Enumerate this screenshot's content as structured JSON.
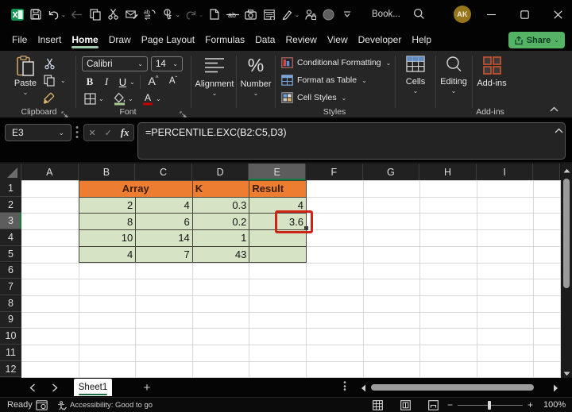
{
  "colors": {
    "excel_green": "#107C41",
    "share_button_green": "#55b366",
    "active_tab_underline": "#9fc7ab",
    "table_header_orange": "#ED7D31",
    "table_header_text": "#3B1D02",
    "table_cell_green": "#D6E4C5",
    "annotation_red": "#CD2418",
    "avatar_gold": "#96751b"
  },
  "title_bar": {
    "title": "Book...",
    "avatar_initials": "AK",
    "quick_access": [
      {
        "name": "excel-logo"
      },
      {
        "name": "save"
      },
      {
        "name": "undo",
        "dropdown": true
      },
      {
        "name": "back",
        "disabled": true
      },
      {
        "name": "copy"
      },
      {
        "name": "cut"
      },
      {
        "name": "email-draft"
      },
      {
        "name": "find-replace"
      },
      {
        "name": "touch-mode",
        "dropdown": true
      },
      {
        "name": "redo",
        "disabled": true,
        "dropdown": true
      },
      {
        "name": "new-file"
      },
      {
        "name": "strikethrough"
      },
      {
        "name": "camera"
      },
      {
        "name": "form"
      },
      {
        "name": "draw",
        "dropdown": true
      },
      {
        "name": "permissions"
      },
      {
        "name": "presence"
      },
      {
        "name": "more-commands"
      }
    ]
  },
  "menu": {
    "tabs": [
      "File",
      "Insert",
      "Home",
      "Draw",
      "Page Layout",
      "Formulas",
      "Data",
      "Review",
      "View",
      "Developer",
      "Help"
    ],
    "active_tab": "Home",
    "share_label": "Share"
  },
  "ribbon": {
    "clipboard": {
      "paste_label": "Paste",
      "group_label": "Clipboard"
    },
    "font": {
      "font_name": "Calibri",
      "font_size": "14",
      "bold": "B",
      "italic": "I",
      "underline": "U",
      "group_label": "Font"
    },
    "alignment": {
      "label": "Alignment"
    },
    "number": {
      "label": "Number"
    },
    "styles": {
      "conditional_formatting": "Conditional Formatting",
      "format_as_table": "Format as Table",
      "cell_styles": "Cell Styles",
      "group_label": "Styles"
    },
    "cells": {
      "label": "Cells"
    },
    "editing": {
      "label": "Editing"
    },
    "addins": {
      "label": "Add-ins",
      "group_label": "Add-ins"
    }
  },
  "formula_bar": {
    "name_box": "E3",
    "formula": "=PERCENTILE.EXC(B2:C5,D3)",
    "fx_label": "fx"
  },
  "grid": {
    "column_headers": [
      "A",
      "B",
      "C",
      "D",
      "E",
      "F",
      "G",
      "H",
      "I"
    ],
    "row_headers": [
      "1",
      "2",
      "3",
      "4",
      "5",
      "6",
      "7",
      "8",
      "9",
      "10",
      "11",
      "12"
    ],
    "selected_column": "E",
    "selected_row": "3",
    "active_cell": "E3",
    "table": {
      "header_row": [
        {
          "text": "Array",
          "colspan": 2,
          "align": "center"
        },
        {
          "text": "K",
          "colspan": 1,
          "align": "left"
        },
        {
          "text": "Result",
          "colspan": 1,
          "align": "left"
        }
      ],
      "rows": [
        [
          "2",
          "4",
          "0.3",
          "4"
        ],
        [
          "8",
          "6",
          "0.2",
          "3.6"
        ],
        [
          "10",
          "14",
          "1",
          ""
        ],
        [
          "4",
          "7",
          "43",
          ""
        ]
      ]
    },
    "annotation": {
      "cell": "E3",
      "value": "3.6"
    }
  },
  "sheet_bar": {
    "tabs": [
      {
        "label": "Sheet1",
        "active": true
      }
    ],
    "new_sheet_label": "+"
  },
  "status_bar": {
    "mode": "Ready",
    "accessibility": "Accessibility: Good to go",
    "zoom_level": "100%"
  }
}
